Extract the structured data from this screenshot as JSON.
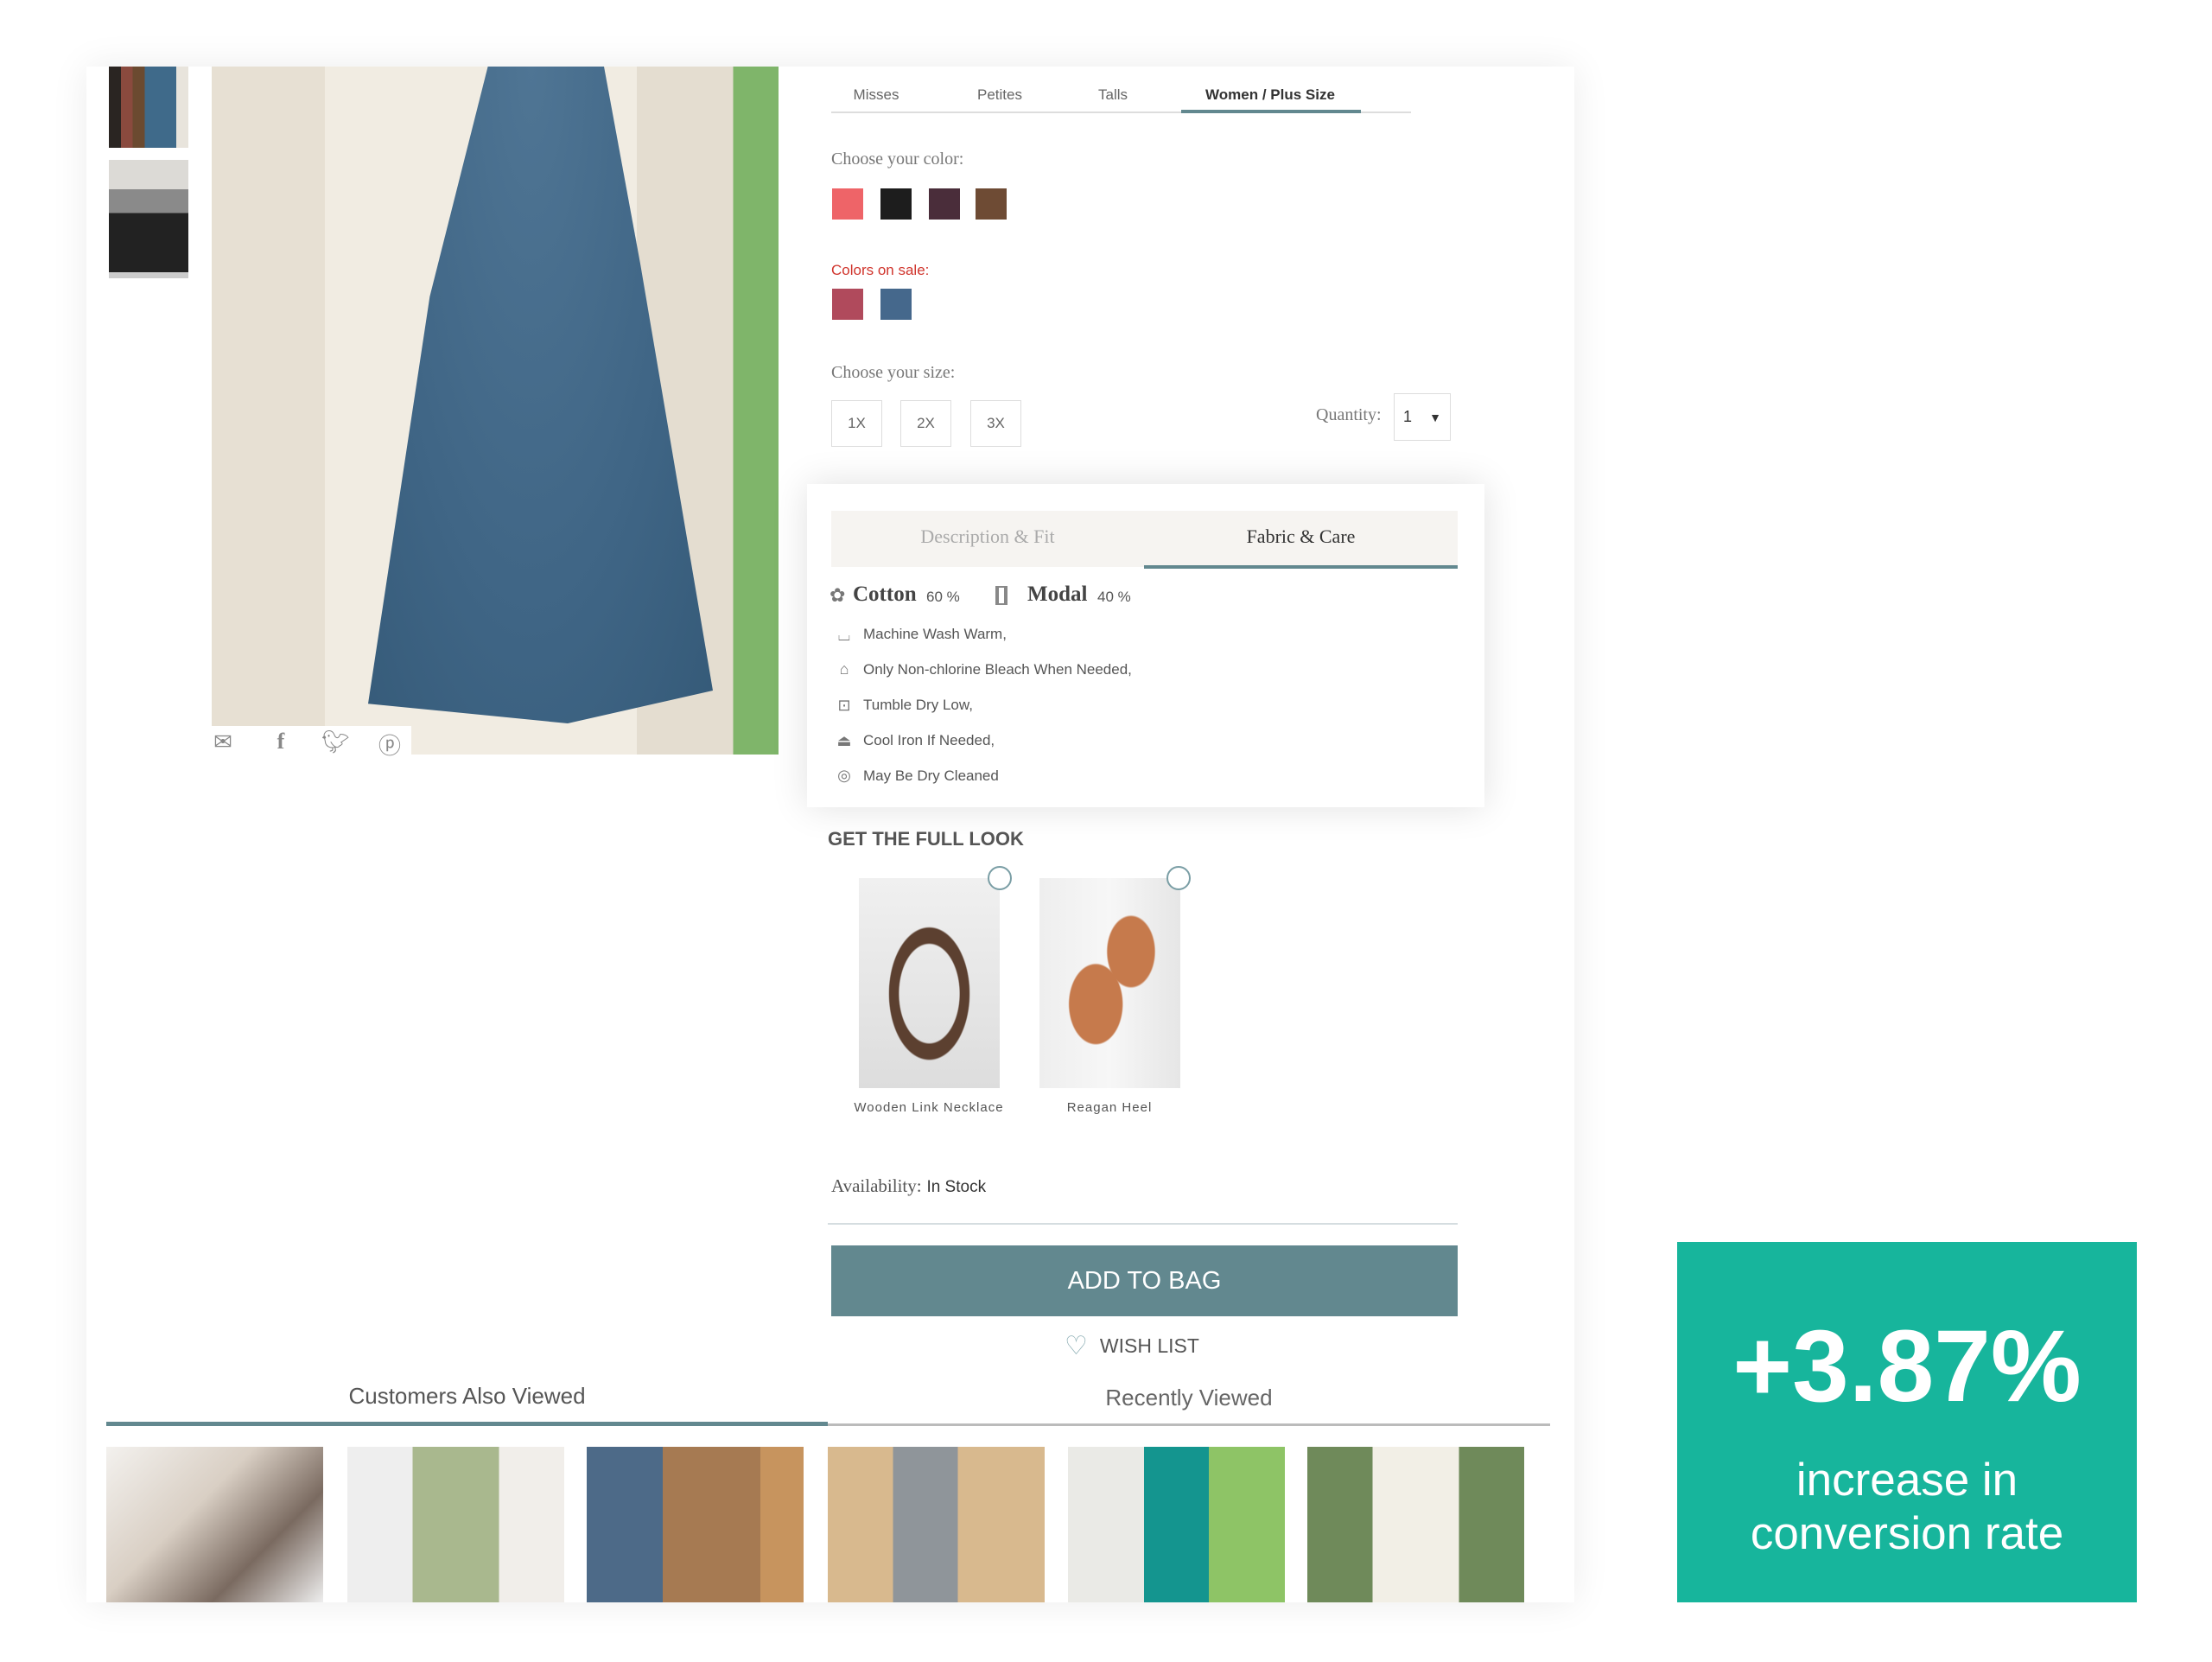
{
  "size_tabs": [
    {
      "label": "Misses"
    },
    {
      "label": "Petites"
    },
    {
      "label": "Talls"
    },
    {
      "label": "Women / Plus Size",
      "active": true
    }
  ],
  "color": {
    "label": "Choose your color:",
    "swatches": [
      "#ee6468",
      "#1d1d1d",
      "#4a2d3a",
      "#6e4b34"
    ]
  },
  "sale": {
    "label": "Colors on sale:",
    "swatches": [
      "#b04a5c",
      "#45688c"
    ],
    "label_color": "#d0342c"
  },
  "size": {
    "label": "Choose your size:",
    "options": [
      "1X",
      "2X",
      "3X"
    ]
  },
  "quantity": {
    "label": "Quantity:",
    "value": "1"
  },
  "social": [
    "email-icon",
    "facebook-icon",
    "twitter-icon",
    "pinterest-icon"
  ],
  "details": {
    "tabs": [
      "Description & Fit",
      "Fabric & Care"
    ],
    "active_tab": "Fabric & Care",
    "fabrics": [
      {
        "name": "Cotton",
        "pct": "60 %",
        "icon": "cotton-icon"
      },
      {
        "name": "Modal",
        "pct": "40 %",
        "icon": "spool-icon"
      }
    ],
    "care": [
      {
        "icon": "machine-wash-icon",
        "text": "Machine Wash Warm,"
      },
      {
        "icon": "bleach-icon",
        "text": "Only Non-chlorine Bleach When Needed,"
      },
      {
        "icon": "tumble-dry-icon",
        "text": "Tumble Dry Low,"
      },
      {
        "icon": "iron-icon",
        "text": "Cool Iron If Needed,"
      },
      {
        "icon": "dry-clean-icon",
        "text": "May Be Dry Cleaned"
      }
    ]
  },
  "full_look": {
    "title": "GET THE FULL LOOK",
    "items": [
      {
        "name": "Wooden Link Necklace"
      },
      {
        "name": "Reagan Heel"
      }
    ]
  },
  "availability": {
    "label": "Availability:",
    "value": "In Stock"
  },
  "add_to_bag": "ADD TO BAG",
  "wish_list": "WISH LIST",
  "bottom_tabs": [
    {
      "label": "Customers Also Viewed",
      "active": true
    },
    {
      "label": "Recently Viewed"
    }
  ],
  "accent": "#62888f",
  "badge": {
    "value": "+3.87%",
    "line1": "increase in",
    "line2": "conversion rate",
    "color": "#17b59c"
  }
}
